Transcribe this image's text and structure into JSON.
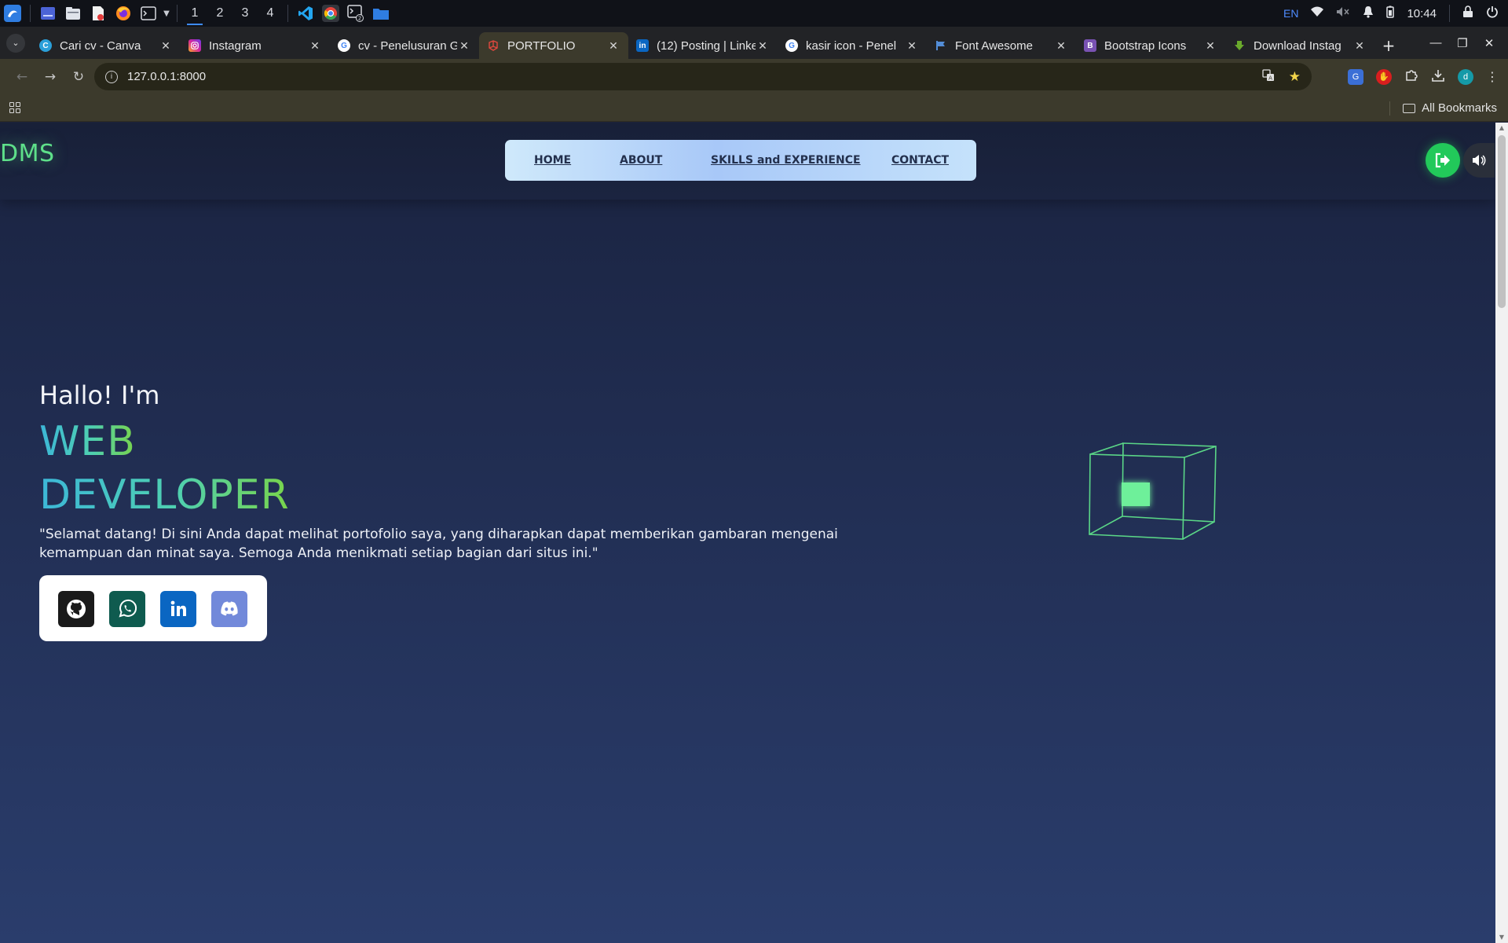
{
  "taskbar": {
    "workspaces": [
      "1",
      "2",
      "3",
      "4"
    ],
    "language": "EN",
    "time": "10:44"
  },
  "tabs": [
    {
      "title": "Cari cv - Canva",
      "favicon": "canva-icon",
      "color": "#2b9fd9"
    },
    {
      "title": "Instagram",
      "favicon": "instagram-icon",
      "color": "#d6249f"
    },
    {
      "title": "cv - Penelusuran G",
      "favicon": "google-icon",
      "color": "#4285f4"
    },
    {
      "title": "PORTFOLIO",
      "favicon": "laravel-icon",
      "color": "#e0483e"
    },
    {
      "title": "(12) Posting | Linke",
      "favicon": "linkedin-icon",
      "color": "#0a66c2"
    },
    {
      "title": "kasir icon - Penel",
      "favicon": "google-icon",
      "color": "#4285f4"
    },
    {
      "title": "Font Awesome",
      "favicon": "font-awesome-flag-icon",
      "color": "#538dd7"
    },
    {
      "title": "Bootstrap Icons",
      "favicon": "bootstrap-icon",
      "color": "#7952b3"
    },
    {
      "title": "Download Instag",
      "favicon": "download-icon",
      "color": "#6aa92c"
    }
  ],
  "toolbar": {
    "url": "127.0.0.1:8000",
    "all_bookmarks": "All Bookmarks",
    "profile_initial": "d"
  },
  "site": {
    "logo": "DMS",
    "nav": [
      "HOME",
      "ABOUT",
      "SKILLS and EXPERIENCE",
      "CONTACT"
    ],
    "greeting": "Hallo! I'm",
    "role_line1": "WEB",
    "role_line2": "DEVELOPER",
    "description": "\"Selamat datang! Di sini Anda dapat melihat portofolio saya, yang diharapkan dapat memberikan gambaran mengenai kemampuan dan minat saya. Semoga Anda menikmati setiap bagian dari situs ini.\"",
    "socials": [
      {
        "name": "github",
        "color": "#1a1a1a"
      },
      {
        "name": "whatsapp",
        "color": "#0f5b4f"
      },
      {
        "name": "linkedin",
        "color": "#0a66c2"
      },
      {
        "name": "discord",
        "color": "#7289da"
      }
    ]
  },
  "colors": {
    "accent_green": "#5ee08a",
    "page_bg": "#233158"
  }
}
